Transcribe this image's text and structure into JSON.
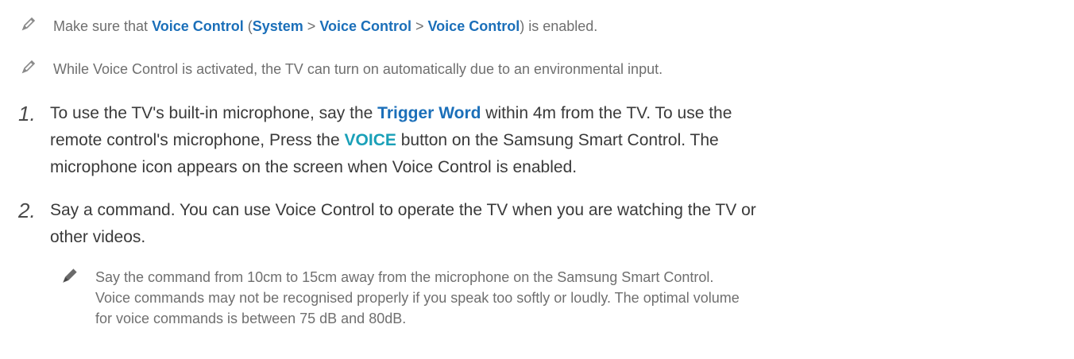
{
  "note1": {
    "t1": "Make sure that ",
    "l1": "Voice Control",
    "t2": " (",
    "l2": "System",
    "t3": " > ",
    "l3": "Voice Control",
    "t4": " > ",
    "l4": "Voice Control",
    "t5": ") is enabled."
  },
  "note2": {
    "text": "While Voice Control is activated, the TV can turn on automatically due to an environmental input."
  },
  "step1": {
    "number": "1.",
    "line1_a": "To use the TV's built-in microphone, say the ",
    "line1_link": "Trigger Word",
    "line1_b": " within 4m from the TV. To use the",
    "line2_a": "remote control's microphone, Press the ",
    "line2_link": "VOICE",
    "line2_b": " button on the Samsung Smart Control. The",
    "line3": "microphone icon appears on the screen when Voice Control is enabled."
  },
  "step2": {
    "number": "2.",
    "line1": "Say a command. You can use Voice Control to operate the TV when you are watching the TV or",
    "line2": "other videos."
  },
  "subnote": {
    "line1": "Say the command from 10cm to 15cm away from the microphone on the Samsung Smart Control.",
    "line2": "Voice commands may not be recognised properly if you speak too softly or loudly. The optimal volume",
    "line3": "for voice commands is between 75 dB and 80dB."
  },
  "icons": {
    "note_icon": "pencil-icon"
  },
  "colors": {
    "link_blue": "#1b6fb9",
    "link_teal": "#1aa0b8",
    "note_gray": "#6f6f6f",
    "body_text": "#3a3a3a"
  }
}
